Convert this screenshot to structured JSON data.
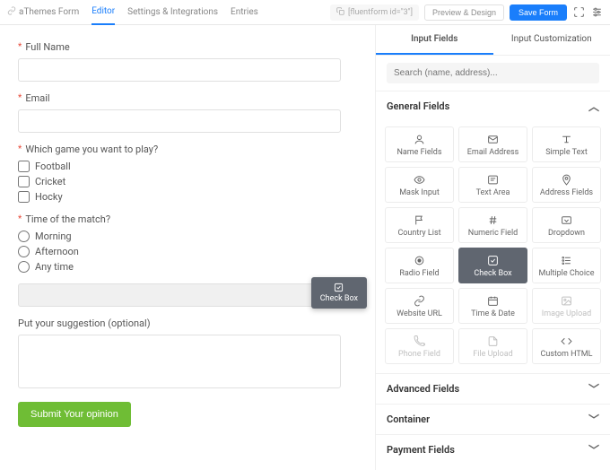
{
  "header": {
    "brand": "aThemes Form",
    "tabs": [
      "Editor",
      "Settings & Integrations",
      "Entries"
    ],
    "active_tab": 0,
    "shortcode": "[fluentform id=\"3\"]",
    "preview_btn": "Preview & Design",
    "save_btn": "Save Form"
  },
  "form": {
    "fields": {
      "fullname": {
        "label": "Full Name",
        "required": true
      },
      "email": {
        "label": "Email",
        "required": true
      },
      "game": {
        "label": "Which game you want to play?",
        "required": true,
        "options": [
          "Football",
          "Cricket",
          "Hocky"
        ]
      },
      "time": {
        "label": "Time of the match?",
        "required": true,
        "options": [
          "Morning",
          "Afternoon",
          "Any time"
        ]
      },
      "suggestion": {
        "label": "Put your suggestion (optional)"
      }
    },
    "submit_label": "Submit Your opinion",
    "drag_chip": "Check Box"
  },
  "sidebar": {
    "tabs": [
      "Input Fields",
      "Input Customization"
    ],
    "active_tab": 0,
    "search_placeholder": "Search (name, address)...",
    "sections": {
      "general": "General Fields",
      "advanced": "Advanced Fields",
      "container": "Container",
      "payment": "Payment Fields"
    },
    "general_items": [
      {
        "id": "name",
        "label": "Name Fields"
      },
      {
        "id": "email",
        "label": "Email Address"
      },
      {
        "id": "text",
        "label": "Simple Text"
      },
      {
        "id": "mask",
        "label": "Mask Input"
      },
      {
        "id": "textarea",
        "label": "Text Area"
      },
      {
        "id": "address",
        "label": "Address Fields"
      },
      {
        "id": "country",
        "label": "Country List"
      },
      {
        "id": "numeric",
        "label": "Numeric Field"
      },
      {
        "id": "dropdown",
        "label": "Dropdown"
      },
      {
        "id": "radio",
        "label": "Radio Field"
      },
      {
        "id": "checkbox",
        "label": "Check Box",
        "active": true
      },
      {
        "id": "multi",
        "label": "Multiple Choice"
      },
      {
        "id": "url",
        "label": "Website URL"
      },
      {
        "id": "date",
        "label": "Time & Date"
      },
      {
        "id": "image",
        "label": "Image Upload",
        "disabled": true
      },
      {
        "id": "phone",
        "label": "Phone Field",
        "disabled": true
      },
      {
        "id": "file",
        "label": "File Upload",
        "disabled": true
      },
      {
        "id": "html",
        "label": "Custom HTML"
      }
    ]
  }
}
